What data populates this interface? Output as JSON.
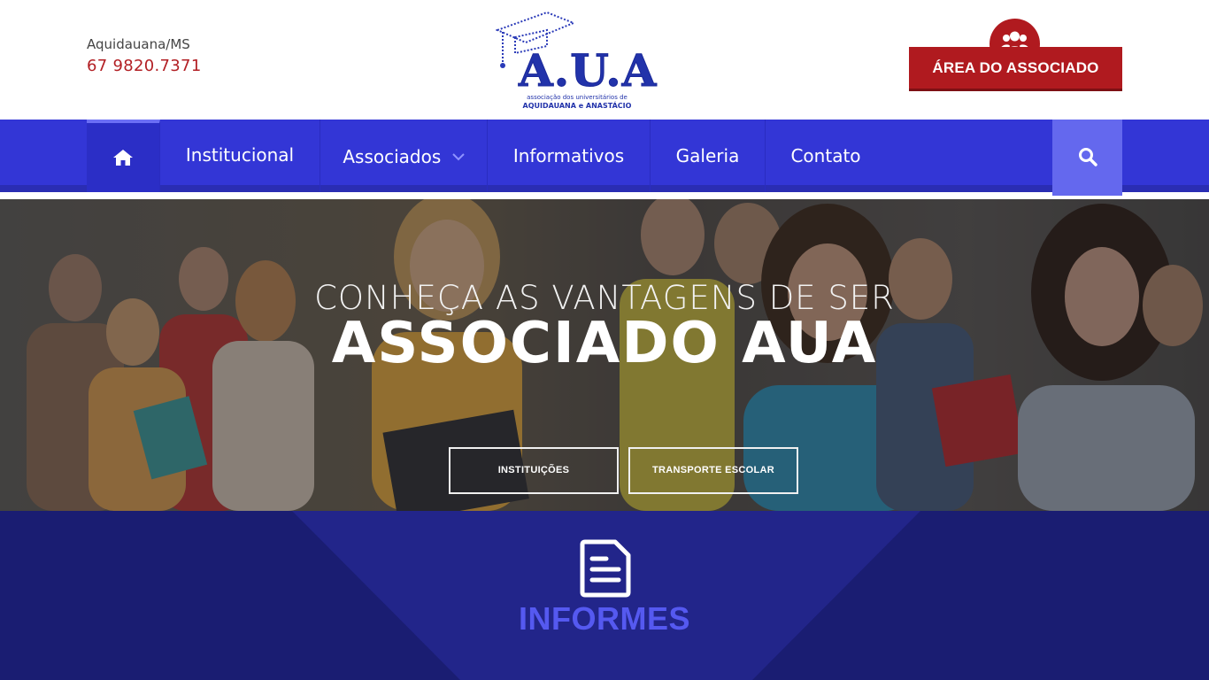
{
  "header": {
    "city": "Aquidauana/MS",
    "phone": "67 9820.7371",
    "logo": {
      "title": "A.U.A",
      "subtitle_line1": "associação dos universitários de",
      "subtitle_line2": "AQUIDAUANA e ANASTÁCIO"
    },
    "member_area_button": "ÁREA DO ASSOCIADO",
    "member_area_icon": "users-icon"
  },
  "nav": {
    "home_icon": "home-icon",
    "items": [
      {
        "label": "Institucional"
      },
      {
        "label": "Associados",
        "has_dropdown": true
      },
      {
        "label": "Informativos"
      },
      {
        "label": "Galeria"
      },
      {
        "label": "Contato"
      }
    ],
    "search_icon": "search-icon"
  },
  "hero": {
    "line1": "CONHEÇA AS VANTAGENS DE SER",
    "line2": "ASSOCIADO AUA",
    "buttons": [
      "INSTITUIÇÕES",
      "TRANSPORTE ESCOLAR"
    ]
  },
  "informes": {
    "icon": "document-icon",
    "title": "INFORMES"
  },
  "colors": {
    "brand_red": "#b01a1f",
    "nav_blue": "#3336d6",
    "informes_bg": "#1c1f7a",
    "informes_title": "#5559f0"
  }
}
